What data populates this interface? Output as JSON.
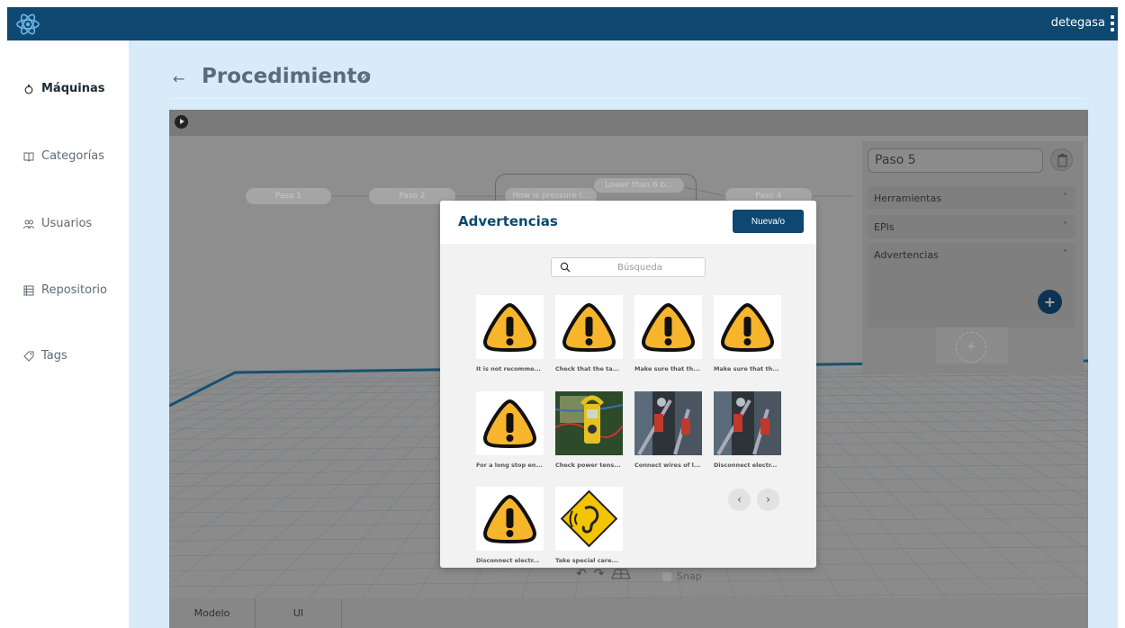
{
  "header": {
    "user": "detegasa",
    "logo_icon": "react-atom-icon"
  },
  "sidebar": {
    "items": [
      {
        "label": "Máquinas",
        "icon": "machine-icon",
        "active": true
      },
      {
        "label": "Categorías",
        "icon": "book-icon",
        "active": false
      },
      {
        "label": "Usuarios",
        "icon": "users-icon",
        "active": false
      },
      {
        "label": "Repositorio",
        "icon": "list-icon",
        "active": false
      },
      {
        "label": "Tags",
        "icon": "tag-icon",
        "active": false
      }
    ]
  },
  "page": {
    "back": "←",
    "title": "Procedimiento"
  },
  "flow": {
    "nodes": [
      "Paso 1",
      "Paso 2",
      "How is pressure l...",
      "Lower than 6 b...",
      "Paso 4"
    ]
  },
  "step_panel": {
    "step_name": "Paso 5",
    "sections": [
      {
        "label": "Herramientas",
        "chevron": "˅"
      },
      {
        "label": "EPIs",
        "chevron": "˅"
      },
      {
        "label": "Advertencias",
        "chevron": "˄"
      }
    ]
  },
  "viewer": {
    "tabs": [
      "Modelo",
      "UI"
    ],
    "snap_label": "Snap",
    "undo": "↶",
    "redo": "↷"
  },
  "modal": {
    "title": "Advertencias",
    "new_button": "Nueva/o",
    "search_placeholder": "Búsqueda",
    "cards": [
      {
        "label": "It is not recomme...",
        "image": "warning-icon"
      },
      {
        "label": "Check that the ta...",
        "image": "warning-icon"
      },
      {
        "label": "Make sure that th...",
        "image": "warning-icon"
      },
      {
        "label": "Make sure that th...",
        "image": "warning-icon"
      },
      {
        "label": "For a long stop en...",
        "image": "warning-icon"
      },
      {
        "label": "Check power tens...",
        "image": "clamp-meter-photo"
      },
      {
        "label": "Connect wires of l...",
        "image": "wires-photo"
      },
      {
        "label": "Disconnect electr...",
        "image": "wires-photo"
      },
      {
        "label": "Disconnect electr...",
        "image": "warning-icon"
      },
      {
        "label": "Take special care...",
        "image": "hearing-protection-sign"
      }
    ],
    "prev": "‹",
    "next": "›"
  },
  "colors": {
    "brand": "#0e4870",
    "main_bg": "#d8ebf9",
    "warning_yellow": "#f7b52c"
  }
}
